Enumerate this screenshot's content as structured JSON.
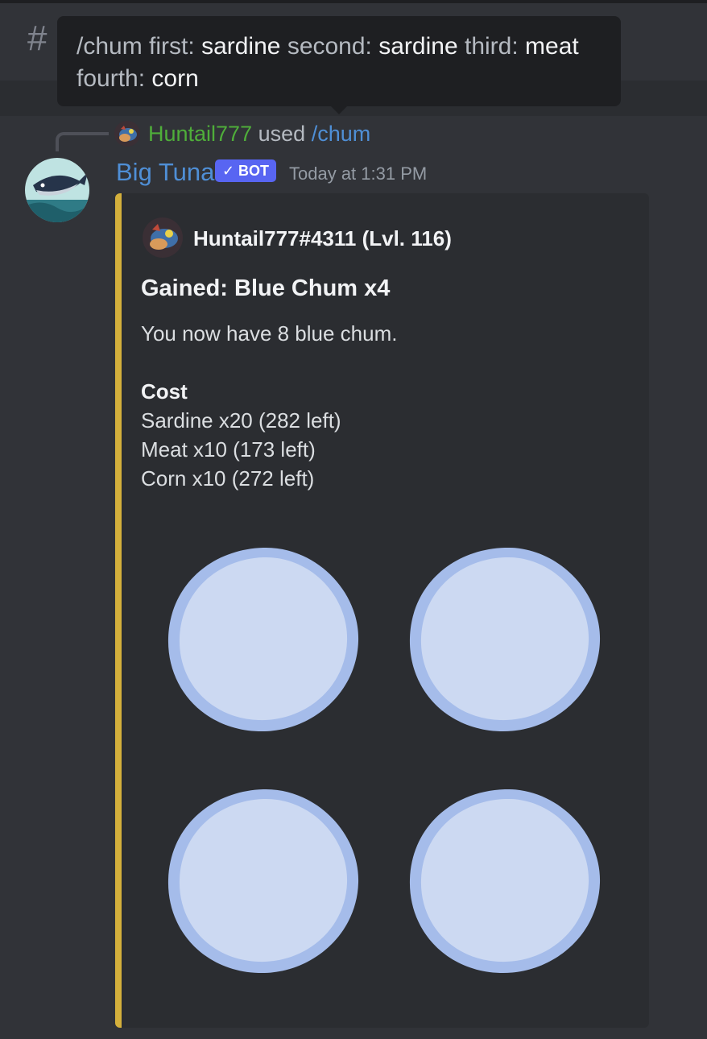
{
  "channel": {
    "icon": "hash-icon"
  },
  "tooltip": {
    "command": "/chum",
    "options": [
      {
        "name": "first:",
        "value": "sardine"
      },
      {
        "name": "second:",
        "value": "sardine"
      },
      {
        "name": "third:",
        "value": "meat"
      },
      {
        "name": "fourth:",
        "value": "corn"
      }
    ]
  },
  "reply": {
    "username": "Huntail777",
    "used": "used",
    "command": "/chum"
  },
  "message": {
    "author": "Big Tuna",
    "badge": "BOT",
    "timestamp": "Today at 1:31 PM"
  },
  "embed": {
    "accent_color": "#d4b03c",
    "author": "Huntail777#4311 (Lvl. 116)",
    "title": "Gained: Blue Chum x4",
    "description": "You now have 8 blue chum.",
    "cost_label": "Cost",
    "cost_lines": [
      "Sardine x20 (282 left)",
      "Meat x10 (173 left)",
      "Corn x10 (272 left)"
    ],
    "images": [
      "blue-chum-icon",
      "blue-chum-icon",
      "blue-chum-icon",
      "blue-chum-icon"
    ]
  },
  "colors": {
    "username_green": "#4fae3a",
    "bot_name_blue": "#4f8fd6",
    "badge": "#5865f2",
    "chum_fill": "#ccd9f2",
    "chum_ring": "#a5bcea"
  }
}
